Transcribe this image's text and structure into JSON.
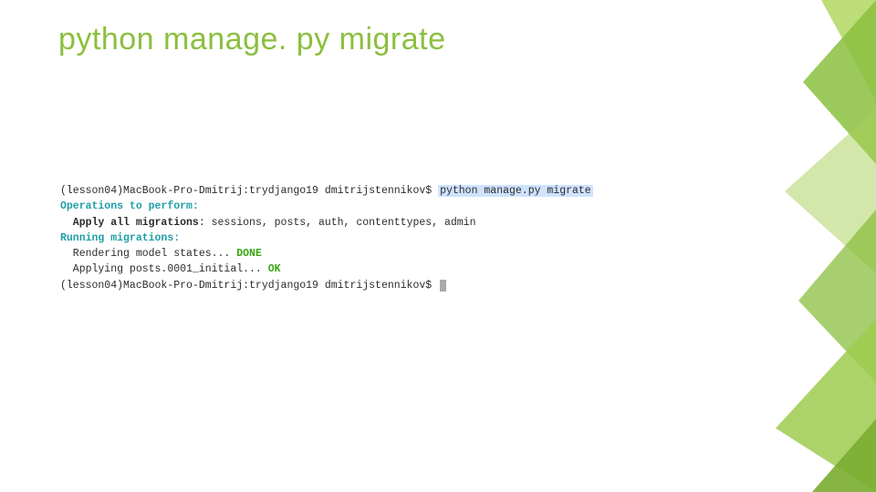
{
  "title": "python manage. py migrate",
  "colors": {
    "accent": "#8bbf3f",
    "terminal_highlight_bg": "#cfe3ff",
    "terminal_teal": "#1f9ea5",
    "terminal_green": "#3aa60f"
  },
  "terminal": {
    "prompt1_prefix": "(lesson04)MacBook-Pro-Dmitrij:trydjango19 dmitrijstennikov$ ",
    "prompt1_command": "python manage.py migrate",
    "operations_header": "Operations to perform:",
    "apply_all_label": "  Apply all migrations",
    "apply_all_list": ": sessions, posts, auth, contenttypes, admin",
    "running_header": "Running migrations:",
    "rendering_prefix": "  Rendering model states... ",
    "rendering_status": "DONE",
    "applying_prefix": "  Applying posts.0001_initial... ",
    "applying_status": "OK",
    "prompt2_prefix": "(lesson04)MacBook-Pro-Dmitrij:trydjango19 dmitrijstennikov$ "
  }
}
